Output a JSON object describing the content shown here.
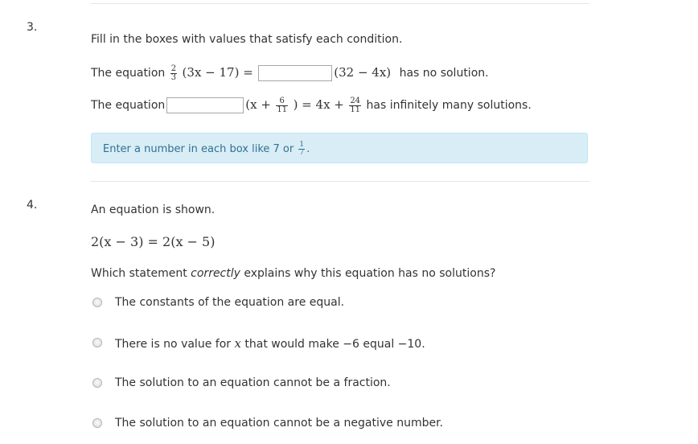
{
  "q3": {
    "number": "3.",
    "prompt": "Fill in the boxes with values that satisfy each condition.",
    "line1": {
      "lead": "The equation",
      "frac_num": "2",
      "frac_den": "3",
      "expr_a": "(3x − 17) =",
      "expr_b": "(32 − 4x)",
      "tail": "has no solution."
    },
    "line2": {
      "lead": "The equation",
      "expr_open": "(x +",
      "frac1_num": "6",
      "frac1_den": "11",
      "expr_mid": ") = 4x +",
      "frac2_num": "24",
      "frac2_den": "11",
      "tail": "has infinitely many solutions."
    },
    "hint": {
      "text": "Enter a number in each box like 7 or",
      "frac_num": "1",
      "frac_den": "7",
      "end": "."
    },
    "hint_color": "#d9edf7"
  },
  "q4": {
    "number": "4.",
    "intro": "An equation is shown.",
    "equation": "2(x − 3) = 2(x − 5)",
    "question_pre": "Which statement",
    "question_em": "correctly",
    "question_post": "explains why this equation has no solutions?",
    "options": [
      {
        "text": "The constants of the equation are equal."
      },
      {
        "pre": "There is no value for",
        "var": "x",
        "post": "that would make −6 equal −10."
      },
      {
        "text": "The solution to an equation cannot be a fraction."
      },
      {
        "text": "The solution to an equation cannot be a negative number."
      }
    ]
  }
}
